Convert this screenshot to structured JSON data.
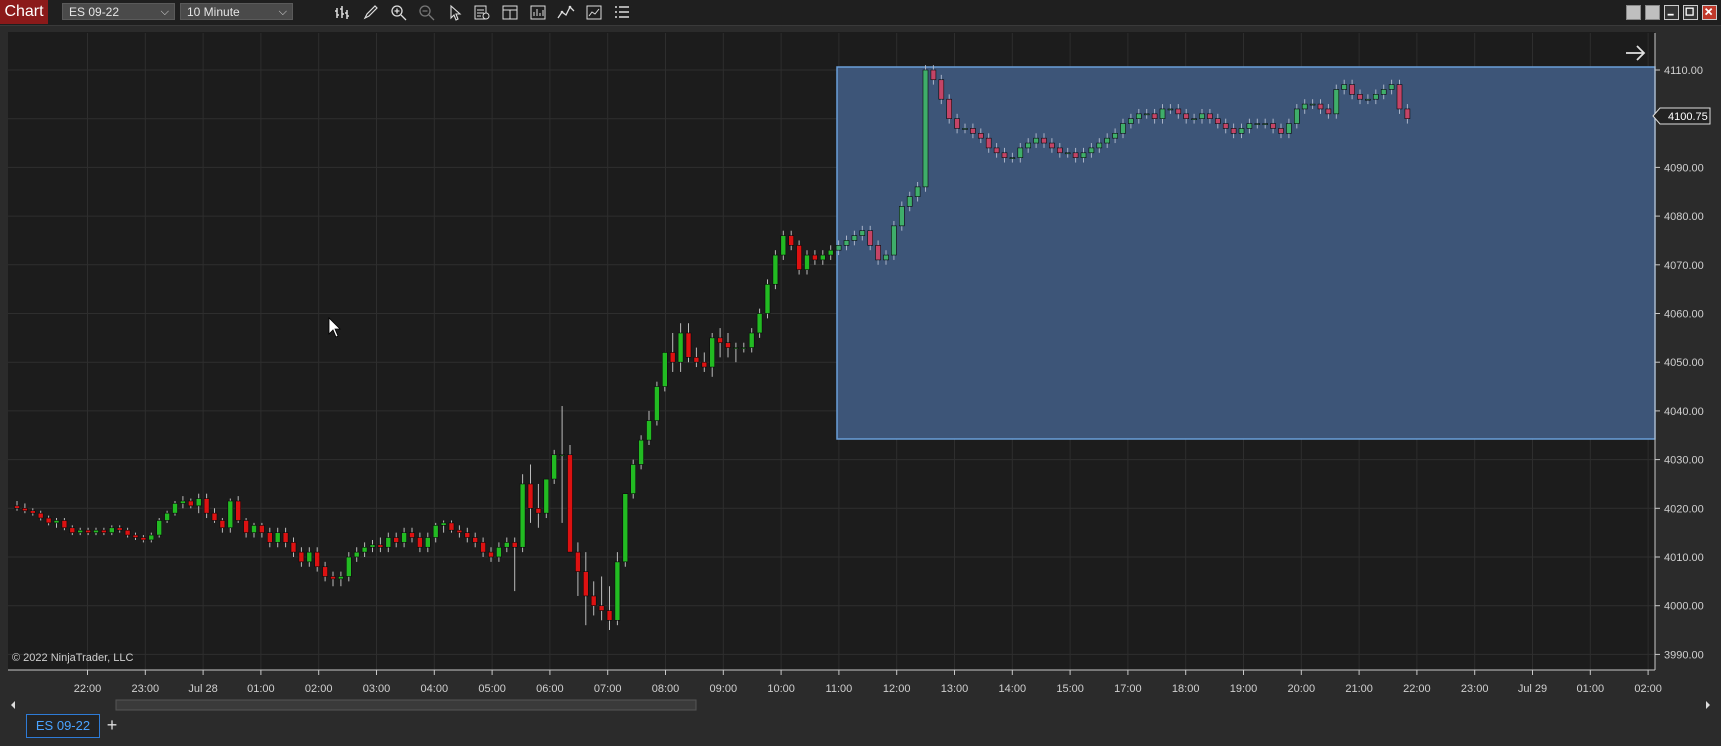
{
  "toolbar": {
    "title": "Chart",
    "instrument": "ES 09-22",
    "interval": "10 Minute",
    "icons": [
      "bar-type-icon",
      "drawing-tool-icon",
      "zoom-in-icon",
      "zoom-out-icon",
      "pointer-icon",
      "data-box-icon",
      "chart-trader-icon",
      "templates-icon",
      "indicators-icon",
      "strategies-icon",
      "properties-icon"
    ]
  },
  "window": {
    "buttons": [
      "tile-icon",
      "tile-icon",
      "minimize-icon",
      "maximize-icon",
      "close-icon"
    ]
  },
  "chart": {
    "copyright": "© 2022 NinjaTrader, LLC",
    "price_label": "4100.75",
    "accent_up": "#22bb22",
    "accent_down": "#dd1111",
    "selection_color": "#3d5578"
  },
  "chart_data": {
    "type": "candlestick",
    "y_axis": {
      "range": [
        3987,
        4118
      ],
      "ticks": [
        "4110.00",
        "4100.00",
        "4090.00",
        "4080.00",
        "4070.00",
        "4060.00",
        "4050.00",
        "4040.00",
        "4030.00",
        "4020.00",
        "4010.00",
        "4000.00",
        "3990.00"
      ],
      "tick_values": [
        4110,
        4100,
        4090,
        4080,
        4070,
        4060,
        4050,
        4040,
        4030,
        4020,
        4010,
        4000,
        3990
      ]
    },
    "x_axis": {
      "ticks": [
        "22:00",
        "23:00",
        "Jul 28",
        "01:00",
        "02:00",
        "03:00",
        "04:00",
        "05:00",
        "06:00",
        "07:00",
        "08:00",
        "09:00",
        "10:00",
        "11:00",
        "12:00",
        "13:00",
        "14:00",
        "15:00",
        "17:00",
        "18:00",
        "19:00",
        "20:00",
        "21:00",
        "22:00",
        "23:00",
        "Jul 29",
        "01:00",
        "02:00"
      ]
    },
    "candles": [
      [
        4020.5,
        4021.5,
        4019.5,
        4020
      ],
      [
        4020,
        4021,
        4019,
        4019.5
      ],
      [
        4019.5,
        4020,
        4018.5,
        4019
      ],
      [
        4019,
        4019.5,
        4017.5,
        4018
      ],
      [
        4018,
        4018.5,
        4016.5,
        4017
      ],
      [
        4017,
        4018,
        4016,
        4017.5
      ],
      [
        4017.5,
        4018,
        4015.5,
        4016
      ],
      [
        4016,
        4016.5,
        4014.5,
        4015
      ],
      [
        4015,
        4016,
        4014.5,
        4015.5
      ],
      [
        4015.5,
        4016,
        4014.5,
        4015
      ],
      [
        4015,
        4016,
        4014.5,
        4015.5
      ],
      [
        4015.5,
        4016,
        4014.5,
        4015
      ],
      [
        4015,
        4016.5,
        4014.5,
        4016
      ],
      [
        4016,
        4016.5,
        4015,
        4015.5
      ],
      [
        4015.5,
        4016,
        4014,
        4014.5
      ],
      [
        4014.5,
        4015,
        4013.5,
        4014
      ],
      [
        4014,
        4014.5,
        4013,
        4013.5
      ],
      [
        4013.5,
        4015,
        4013,
        4014.5
      ],
      [
        4014.5,
        4018,
        4014,
        4017.5
      ],
      [
        4017.5,
        4019.5,
        4017,
        4019
      ],
      [
        4019,
        4021.5,
        4018.5,
        4021
      ],
      [
        4021,
        4022.5,
        4020,
        4021.5
      ],
      [
        4021.5,
        4022,
        4020,
        4020.5
      ],
      [
        4020.5,
        4023,
        4019,
        4022
      ],
      [
        4022,
        4023,
        4018,
        4019
      ],
      [
        4019,
        4020,
        4017,
        4017.5
      ],
      [
        4017.5,
        4018,
        4015,
        4016
      ],
      [
        4016,
        4022,
        4015,
        4021.5
      ],
      [
        4021.5,
        4022.5,
        4017,
        4017.5
      ],
      [
        4017.5,
        4018,
        4014,
        4015
      ],
      [
        4015,
        4017,
        4014,
        4016.5
      ],
      [
        4016.5,
        4017,
        4014,
        4015
      ],
      [
        4015,
        4016,
        4012,
        4013
      ],
      [
        4013,
        4016,
        4012,
        4015
      ],
      [
        4015,
        4016,
        4012,
        4013
      ],
      [
        4013,
        4014,
        4010,
        4011
      ],
      [
        4011,
        4012,
        4008,
        4009
      ],
      [
        4009,
        4012,
        4008,
        4011
      ],
      [
        4011,
        4012,
        4007,
        4008
      ],
      [
        4008,
        4009,
        4005,
        4006
      ],
      [
        4006,
        4007,
        4004,
        4005.5
      ],
      [
        4005.5,
        4007,
        4004,
        4006
      ],
      [
        4006,
        4011,
        4005,
        4010
      ],
      [
        4010,
        4012,
        4009,
        4011
      ],
      [
        4011,
        4013,
        4010,
        4012
      ],
      [
        4012,
        4013.5,
        4011,
        4012.5
      ],
      [
        4012.5,
        4014,
        4011,
        4012
      ],
      [
        4012,
        4015,
        4011,
        4014
      ],
      [
        4014,
        4015,
        4012,
        4013
      ],
      [
        4013,
        4016,
        4012,
        4015
      ],
      [
        4015,
        4016,
        4013,
        4014
      ],
      [
        4014,
        4015,
        4011,
        4012
      ],
      [
        4012,
        4015,
        4011,
        4014
      ],
      [
        4014,
        4017,
        4013,
        4016.5
      ],
      [
        4016.5,
        4017.5,
        4015,
        4017
      ],
      [
        4017,
        4017.5,
        4015,
        4015.5
      ],
      [
        4015.5,
        4016.5,
        4014,
        4015
      ],
      [
        4015,
        4016,
        4013,
        4014
      ],
      [
        4014,
        4015,
        4012,
        4013
      ],
      [
        4013,
        4014,
        4010,
        4011
      ],
      [
        4011,
        4012,
        4009,
        4010
      ],
      [
        4010,
        4013,
        4009,
        4012
      ],
      [
        4012,
        4014,
        4011,
        4013
      ],
      [
        4013,
        4014,
        4003,
        4012
      ],
      [
        4012,
        4027,
        4011,
        4025
      ],
      [
        4025,
        4029,
        4017,
        4020
      ],
      [
        4020,
        4025,
        4016,
        4019
      ],
      [
        4019,
        4026,
        4018,
        4026
      ],
      [
        4026,
        4032,
        4025,
        4031
      ],
      [
        4031,
        4041,
        4017,
        4031
      ],
      [
        4031,
        4033,
        4012,
        4011
      ],
      [
        4011,
        4013,
        4002,
        4007
      ],
      [
        4007,
        4011,
        3996,
        4002
      ],
      [
        4002,
        4005,
        3998,
        4000
      ],
      [
        4000,
        4006,
        3997,
        3999
      ],
      [
        3999,
        4004,
        3995,
        3997
      ],
      [
        3997,
        4011,
        3996,
        4009
      ],
      [
        4009,
        4023,
        4008,
        4023
      ],
      [
        4023,
        4030,
        4022,
        4029
      ],
      [
        4029,
        4035,
        4028,
        4034
      ],
      [
        4034,
        4040,
        4033,
        4038
      ],
      [
        4038,
        4046,
        4037,
        4045
      ],
      [
        4045,
        4052,
        4044,
        4052
      ],
      [
        4052,
        4056,
        4048,
        4050
      ],
      [
        4050,
        4058,
        4048,
        4056
      ],
      [
        4056,
        4058,
        4050,
        4051
      ],
      [
        4051,
        4053,
        4049,
        4050
      ],
      [
        4050,
        4052,
        4048,
        4049
      ],
      [
        4049,
        4056,
        4047,
        4055
      ],
      [
        4055,
        4057,
        4051,
        4054
      ],
      [
        4054,
        4056,
        4051,
        4053
      ],
      [
        4053,
        4054,
        4050,
        4053
      ]
    ]
  }
}
